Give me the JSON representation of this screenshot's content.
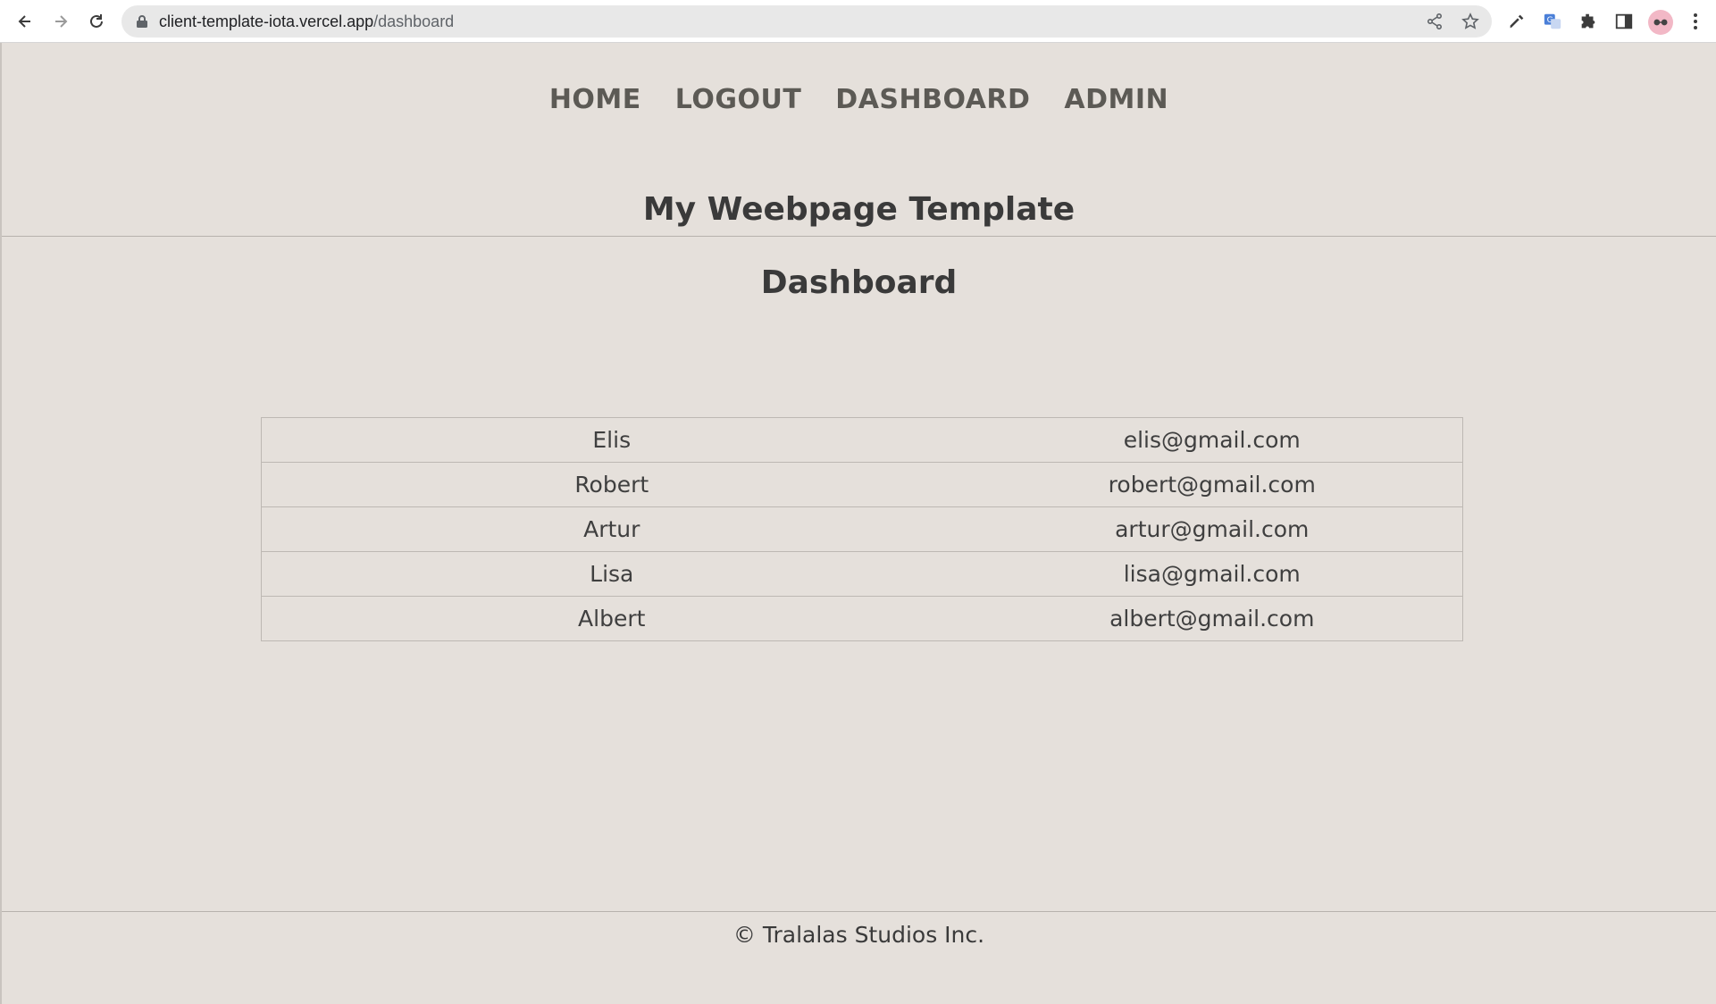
{
  "browser": {
    "url_host": "client-template-iota.vercel.app",
    "url_path": "/dashboard",
    "icons": [
      "back-icon",
      "forward-icon",
      "reload-icon",
      "lock-icon",
      "share-icon",
      "star-icon",
      "eyedropper-icon",
      "translate-icon",
      "extensions-icon",
      "side-panel-icon",
      "profile-avatar",
      "menu-icon"
    ]
  },
  "nav": {
    "items": [
      {
        "label": "HOME"
      },
      {
        "label": "LOGOUT"
      },
      {
        "label": "DASHBOARD"
      },
      {
        "label": "ADMIN"
      }
    ]
  },
  "site_title": "My Weebpage Template",
  "page_title": "Dashboard",
  "users": [
    {
      "name": "Elis",
      "email": "elis@gmail.com"
    },
    {
      "name": "Robert",
      "email": "robert@gmail.com"
    },
    {
      "name": "Artur",
      "email": "artur@gmail.com"
    },
    {
      "name": "Lisa",
      "email": "lisa@gmail.com"
    },
    {
      "name": "Albert",
      "email": "albert@gmail.com"
    }
  ],
  "footer": "© Tralalas Studios Inc.",
  "colors": {
    "page_background": "#e5e0db",
    "nav_text": "#5c5a55",
    "heading_text": "#3a3a3a"
  }
}
